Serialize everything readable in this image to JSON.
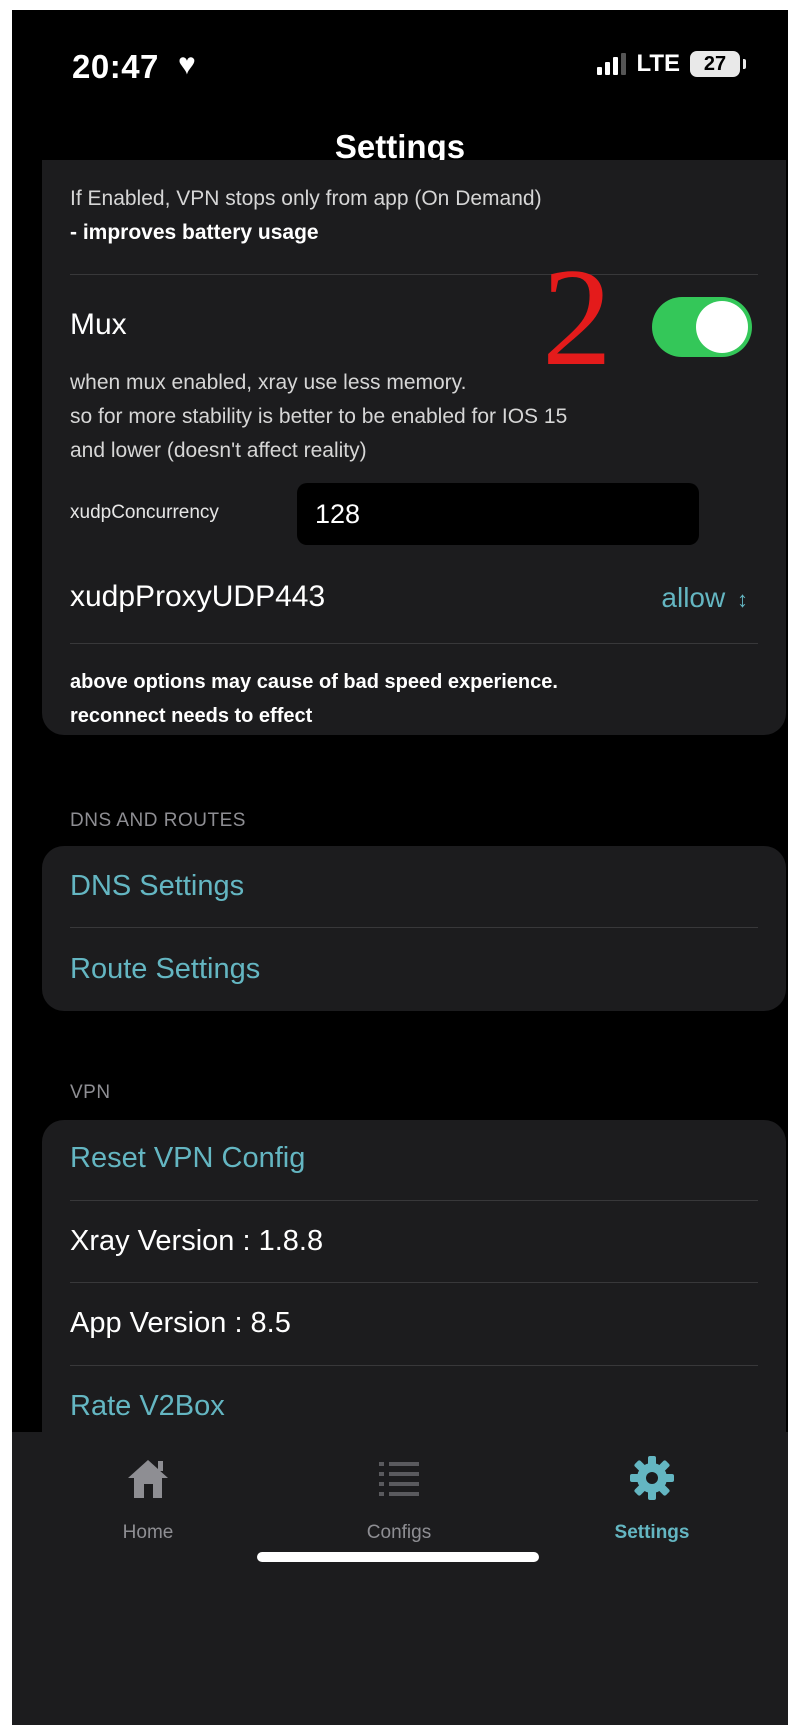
{
  "status": {
    "time": "20:47",
    "network": "LTE",
    "battery": "27"
  },
  "nav": {
    "title": "Settings"
  },
  "ondemand": {
    "line1": "If Enabled, VPN stops only from app (On Demand)",
    "line2": "- improves battery usage"
  },
  "mux": {
    "label": "Mux",
    "enabled": true,
    "desc1": "when mux enabled, xray use less memory.",
    "desc2": "so for more stability is better to be enabled for IOS 15",
    "desc3": "and lower (doesn't affect reality)"
  },
  "annotation": "2",
  "xudp": {
    "concurrency_label": "xudpConcurrency",
    "concurrency_value": "128",
    "proxy_label": "xudpProxyUDP443",
    "proxy_value": "allow"
  },
  "warning": {
    "line1": "above options may cause of bad speed experience.",
    "line2": "reconnect needs to effect"
  },
  "dns_section": {
    "header": "DNS AND ROUTES",
    "items": [
      "DNS Settings",
      "Route Settings"
    ]
  },
  "vpn_section": {
    "header": "VPN",
    "reset": "Reset VPN Config",
    "xray_version": "Xray Version : 1.8.8",
    "app_version": "App Version : 8.5",
    "rate": "Rate V2Box"
  },
  "tabs": [
    {
      "label": "Home",
      "icon": "home-icon"
    },
    {
      "label": "Configs",
      "icon": "list-icon"
    },
    {
      "label": "Settings",
      "icon": "gear-icon",
      "active": true
    }
  ],
  "colors": {
    "accent": "#64b6c2",
    "toggle_on": "#34c759",
    "annotation": "#e41b1b"
  }
}
